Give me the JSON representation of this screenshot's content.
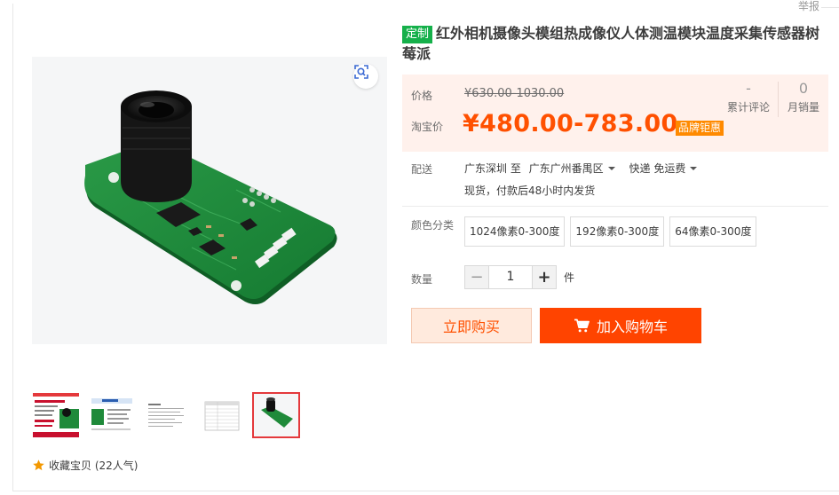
{
  "header": {
    "report_label": "举报"
  },
  "product": {
    "tag": "定制",
    "title": "红外相机摄像头模组热成像仪人体测温模块温度采集传感器树莓派"
  },
  "price_box": {
    "price_label": "价格",
    "original_price": "¥630.00-1030.00",
    "taobao_label": "淘宝价",
    "price": "¥480.00-783.00",
    "brand_badge": "品牌钜惠",
    "reviews_count": "-",
    "reviews_label": "累计评论",
    "monthly_sales": "0",
    "monthly_sales_label": "月销量"
  },
  "shipping": {
    "label": "配送",
    "from": "广东深圳 至",
    "to": "广东广州番禺区",
    "method": "快递 免运费",
    "note": "现货，付款后48小时内发货"
  },
  "sku": {
    "label": "颜色分类",
    "options": [
      "1024像素0-300度",
      "192像素0-300度",
      "64像素0-300度"
    ]
  },
  "quantity": {
    "label": "数量",
    "minus": "−",
    "value": "1",
    "plus": "+",
    "unit": "件"
  },
  "actions": {
    "buy_now": "立即购买",
    "add_to_cart": "加入购物车"
  },
  "favorites": {
    "label": "收藏宝贝 (22人气)"
  },
  "colors": {
    "accent": "#ff5000",
    "cart_button": "#ff4400",
    "tag_green": "#15b04a",
    "badge_orange": "#ff8a00",
    "pcb_green": "#1f8a3a"
  },
  "icons": {
    "zoom": "zoom-scan-icon",
    "cart": "shopping-cart-icon",
    "star": "star-icon"
  }
}
